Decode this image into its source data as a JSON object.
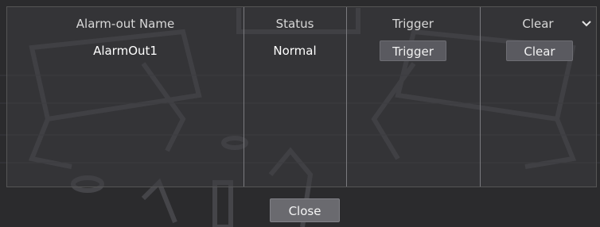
{
  "table": {
    "headers": {
      "name": "Alarm-out Name",
      "status": "Status",
      "trigger": "Trigger",
      "clear": "Clear"
    },
    "rows": [
      {
        "name": "AlarmOut1",
        "status": "Normal",
        "trigger_label": "Trigger",
        "clear_label": "Clear"
      }
    ]
  },
  "footer": {
    "close_label": "Close"
  },
  "icons": {
    "dropdown": "chevron-down-icon"
  },
  "colors": {
    "background": "#2b2b2d",
    "button": "#5a5a60",
    "divider": "#7a7a7e"
  }
}
